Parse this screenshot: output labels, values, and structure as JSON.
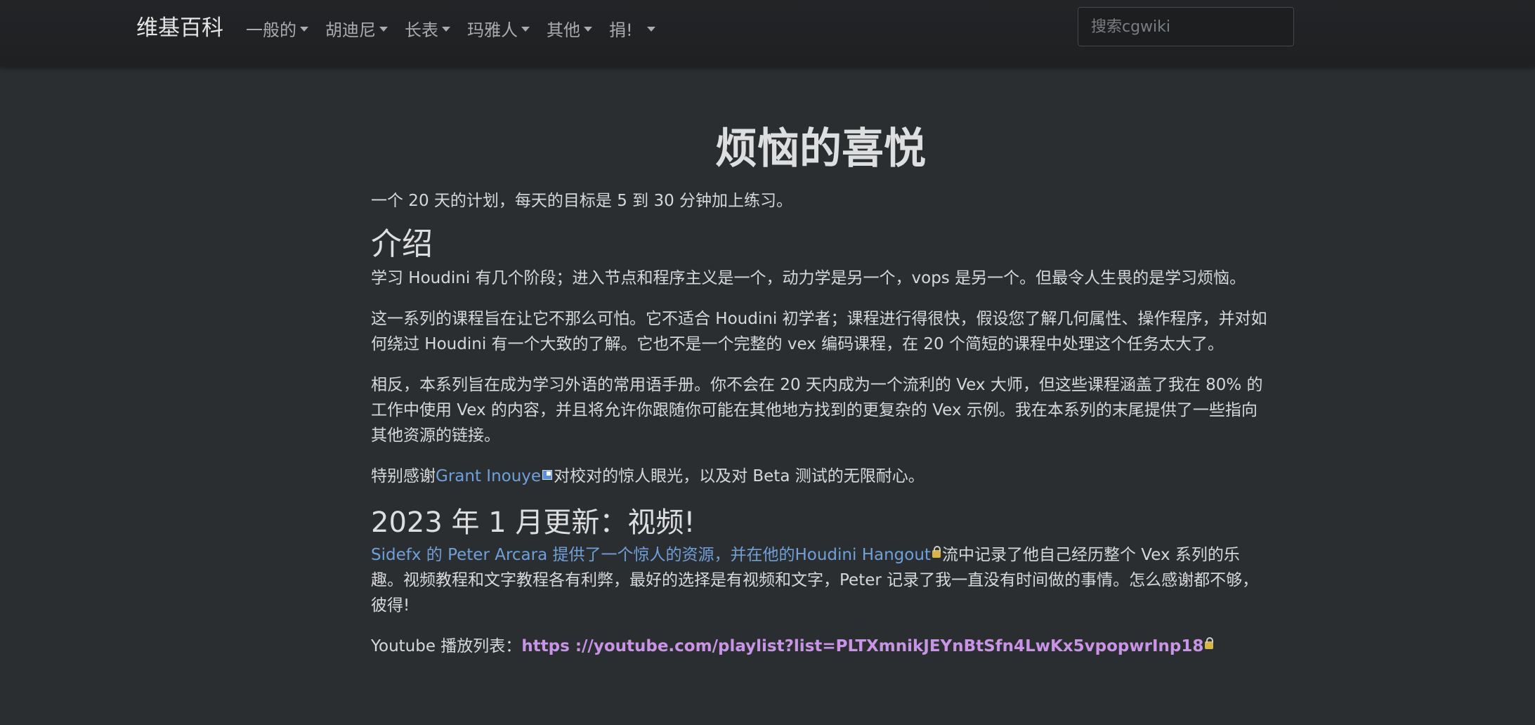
{
  "navbar": {
    "brand": "维基百科",
    "items": [
      {
        "label": "一般的"
      },
      {
        "label": "胡迪尼"
      },
      {
        "label": "长表"
      },
      {
        "label": "玛雅人"
      },
      {
        "label": "其他"
      },
      {
        "label": "捐!"
      }
    ],
    "search_placeholder": "搜索cgwiki"
  },
  "page": {
    "title": "烦恼的喜悦",
    "subtitle": "一个 20 天的计划，每天的目标是 5 到 30 分钟加上练习。",
    "intro_heading": "介绍",
    "intro_p1": "学习 Houdini 有几个阶段；进入节点和程序主义是一个，动力学是另一个，vops 是另一个。但最令人生畏的是学习烦恼。",
    "intro_p2": "这一系列的课程旨在让它不那么可怕。它不适合 Houdini 初学者；课程进行得很快，假设您了解几何属性、操作程序，并对如何绕过 Houdini 有一个大致的了解。它也不是一个完整的 vex 编码课程，在 20 个简短的课程中处理这个任务太大了。",
    "intro_p3": "相反，本系列旨在成为学习外语的常用语手册。你不会在 20 天内成为一个流利的 Vex 大师，但这些课程涵盖了我在 80% 的工作中使用 Vex 的内容，并且将允许你跟随你可能在其他地方找到的更复杂的 Vex 示例。我在本系列的末尾提供了一些指向其他资源的链接。",
    "thanks_prefix": "特别感谢",
    "thanks_link": "Grant Inouye",
    "thanks_suffix": "对校对的惊人眼光，以及对 Beta 测试的无限耐心。",
    "update_heading": "2023 年 1 月更新：视频!",
    "update_link": "Sidefx 的 Peter Arcara 提供了一个惊人的资源，并在他的Houdini Hangout",
    "update_suffix": "流中记录了他自己经历整个 Vex 系列的乐趣。视频教程和文字教程各有利弊，最好的选择是有视频和文字，Peter 记录了我一直没有时间做的事情。怎么感谢都不够，彼得!",
    "youtube_label": "Youtube 播放列表：",
    "youtube_link": "https ://youtube.com/playlist?list=PLTXmnikJEYnBtSfn4LwKx5vpopwrInp18"
  }
}
